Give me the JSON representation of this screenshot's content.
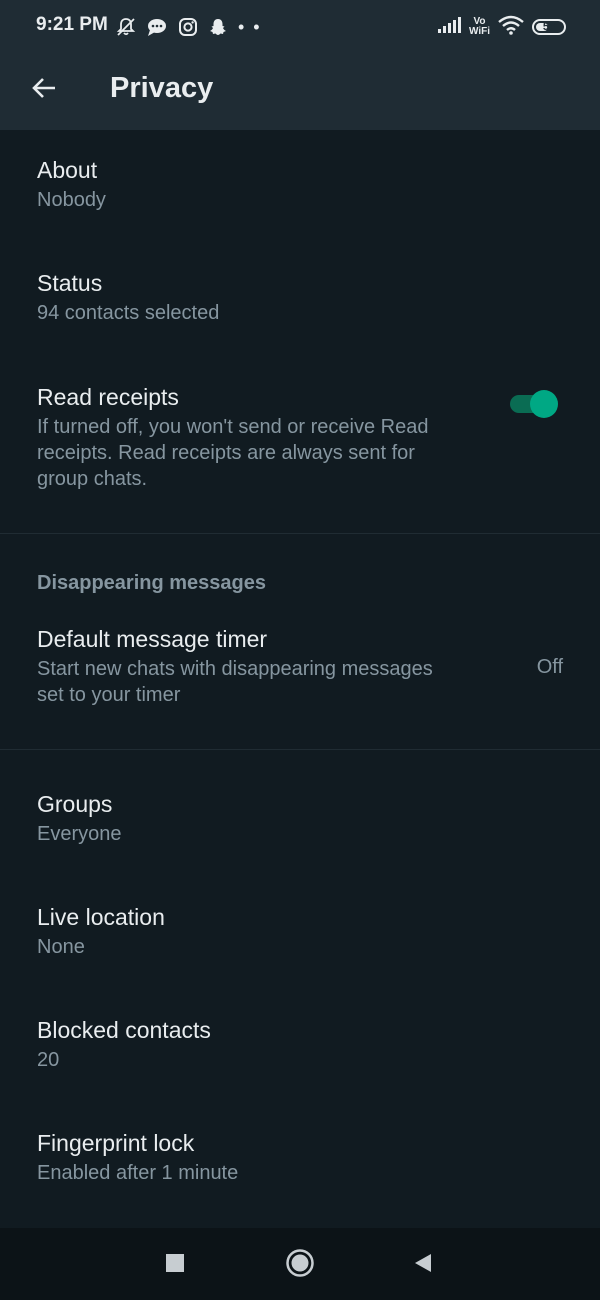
{
  "status_bar": {
    "time": "9:21 PM",
    "left_icons": [
      "mute-bell-icon",
      "chat-bubble-icon",
      "instagram-icon",
      "snapchat-icon"
    ],
    "dots": "• •",
    "volte": "Vo\nWiFi",
    "battery_level": "53",
    "battery_percent": 53
  },
  "app_bar": {
    "back_icon": "arrow-left-icon",
    "title": "Privacy"
  },
  "items": {
    "about": {
      "title": "About",
      "subtitle": "Nobody"
    },
    "status": {
      "title": "Status",
      "subtitle": "94 contacts selected"
    },
    "read_receipts": {
      "title": "Read receipts",
      "subtitle_line1": "If turned off, you won't send or receive Read",
      "subtitle_line2": "receipts. Read receipts are always sent for",
      "subtitle_line3": "group chats.",
      "enabled": true
    },
    "disappearing_header": "Disappearing messages",
    "default_timer": {
      "title": "Default message timer",
      "subtitle_line1": "Start new chats with disappearing messages",
      "subtitle_line2": "set to your timer",
      "value": "Off"
    },
    "groups": {
      "title": "Groups",
      "subtitle": "Everyone"
    },
    "live_location": {
      "title": "Live location",
      "subtitle": "None"
    },
    "blocked_contacts": {
      "title": "Blocked contacts",
      "subtitle": "20"
    },
    "fingerprint_lock": {
      "title": "Fingerprint lock",
      "subtitle": "Enabled after 1 minute"
    }
  },
  "colors": {
    "background": "#111b21",
    "header": "#1f2c34",
    "accent": "#00a884",
    "text_primary": "#e9edef",
    "text_secondary": "#8696a0"
  },
  "nav_bar": {
    "recents_icon": "square-icon",
    "home_icon": "circle-home-icon",
    "back_icon": "triangle-back-icon"
  }
}
